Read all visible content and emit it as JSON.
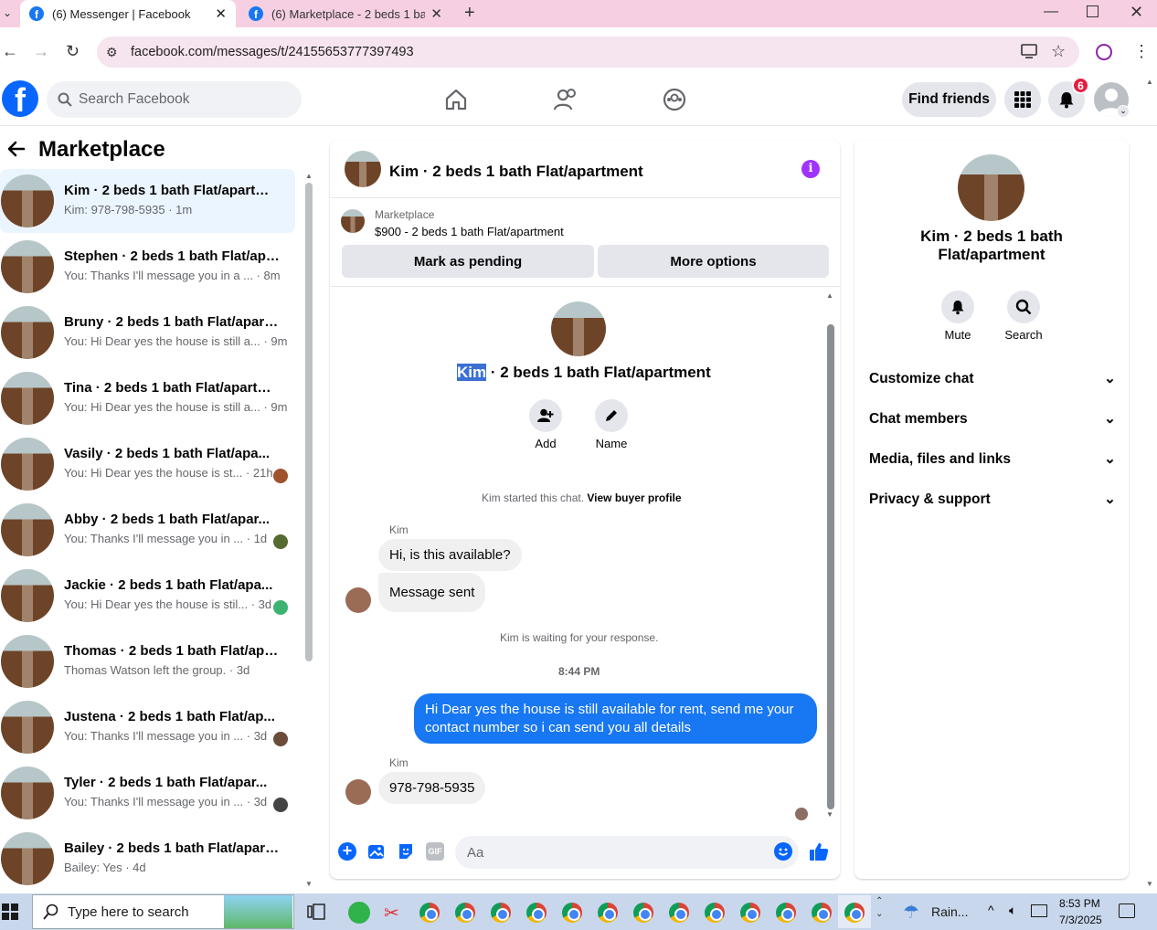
{
  "browser": {
    "tabs": [
      {
        "title": "(6) Messenger | Facebook",
        "active": true
      },
      {
        "title": "(6) Marketplace - 2 beds 1 bath",
        "active": false
      }
    ],
    "url": "facebook.com/messages/t/24155653777397493"
  },
  "header": {
    "search_placeholder": "Search Facebook",
    "find_friends": "Find friends",
    "notification_count": "6"
  },
  "sidebar": {
    "title": "Marketplace",
    "conversations": [
      {
        "name": "Kim · 2 beds 1 bath Flat/apartme...",
        "preview": "Kim: 978-798-5935 · 1m",
        "active": true
      },
      {
        "name": "Stephen · 2 beds 1 bath Flat/apa...",
        "preview": "You: Thanks I'll message you in a ... · 8m"
      },
      {
        "name": "Bruny · 2 beds 1 bath Flat/apart...",
        "preview": "You: Hi Dear yes the house is still a... · 9m"
      },
      {
        "name": "Tina · 2 beds 1 bath Flat/apartm...",
        "preview": "You: Hi Dear yes the house is still a... · 9m"
      },
      {
        "name": "Vasily · 2 beds 1 bath Flat/apa...",
        "preview": "You: Hi Dear yes the house is st... · 21h"
      },
      {
        "name": "Abby · 2 beds 1 bath Flat/apar...",
        "preview": "You: Thanks I'll message you in ... · 1d"
      },
      {
        "name": "Jackie · 2 beds 1 bath Flat/apa...",
        "preview": "You: Hi Dear yes the house is stil... · 3d"
      },
      {
        "name": "Thomas · 2 beds 1 bath Flat/apa...",
        "preview": "Thomas Watson left the group. · 3d"
      },
      {
        "name": "Justena · 2 beds 1 bath Flat/ap...",
        "preview": "You: Thanks I'll message you in ... · 3d"
      },
      {
        "name": "Tyler · 2 beds 1 bath Flat/apar...",
        "preview": "You: Thanks I'll message you in ... · 3d"
      },
      {
        "name": "Bailey · 2 beds 1 bath Flat/apart...",
        "preview": "Bailey: Yes · 4d"
      }
    ]
  },
  "chat": {
    "title": "Kim · 2 beds 1 bath Flat/apartment",
    "listing_source": "Marketplace",
    "listing_title": "$900 - 2 beds 1 bath Flat/apartment",
    "mark_pending": "Mark as pending",
    "more_options": "More options",
    "profile_name_highlight": "Kim",
    "profile_name_rest": " · 2 beds 1 bath Flat/apartment",
    "add_label": "Add",
    "name_label": "Name",
    "started_note": "Kim started this chat.",
    "view_buyer_profile": "View buyer profile",
    "sender_name": "Kim",
    "msg1": "Hi, is this available?",
    "msg2": "Message sent",
    "waiting_note": "Kim is waiting for your response.",
    "timestamp": "8:44 PM",
    "outgoing": "Hi Dear yes the house is still available for rent, send me your contact number so i can send you all details",
    "sender_name2": "Kim",
    "msg3": "978-798-5935",
    "composer_placeholder": "Aa"
  },
  "details": {
    "title": "Kim · 2 beds 1 bath Flat/apartment",
    "mute": "Mute",
    "search": "Search",
    "sections": [
      "Customize chat",
      "Chat members",
      "Media, files and links",
      "Privacy & support"
    ]
  },
  "taskbar": {
    "search_placeholder": "Type here to search",
    "weather": "Rain...",
    "time": "8:53 PM",
    "date": "7/3/2025"
  },
  "colors": {
    "accent": "#0866ff",
    "outgoing_bubble": "#1877f2",
    "info_purple": "#a033ff"
  }
}
